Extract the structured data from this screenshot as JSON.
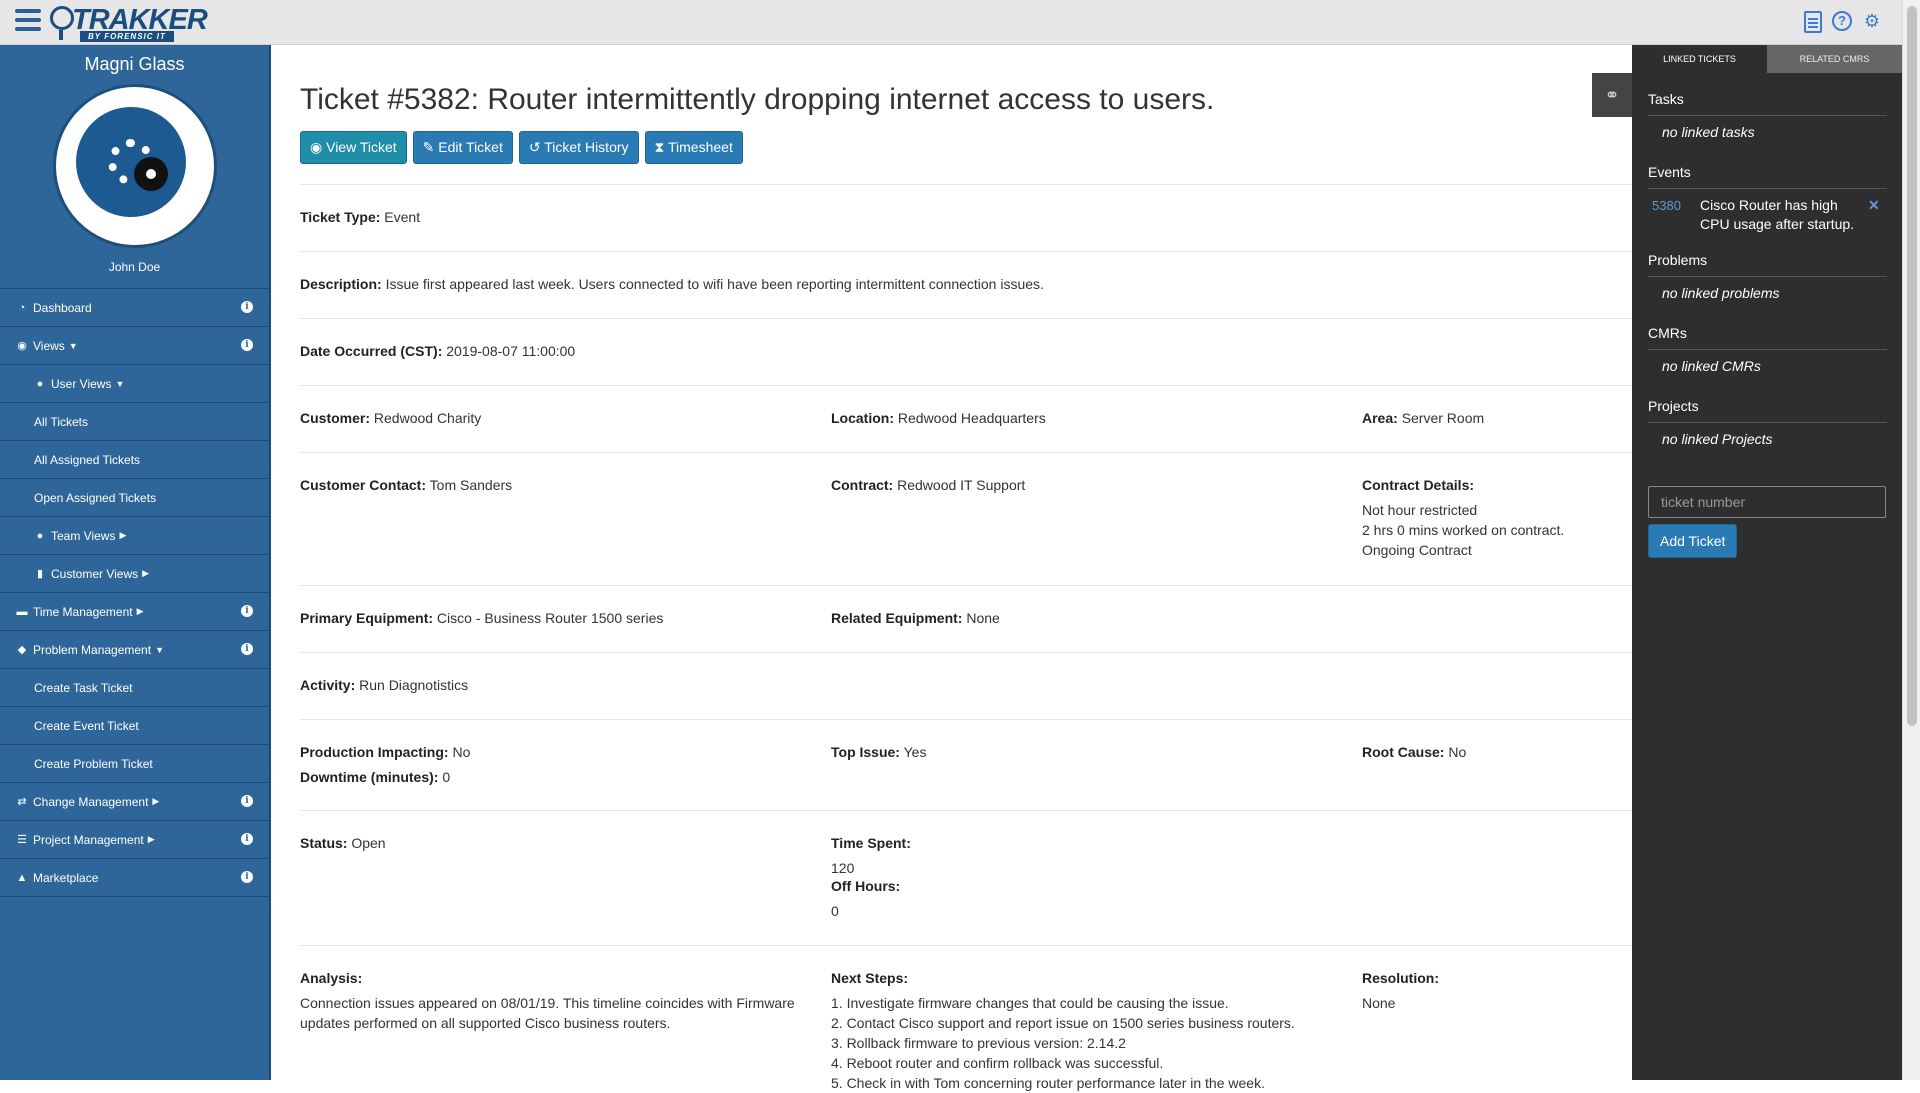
{
  "topbar": {
    "logo_text": "TRAKKER",
    "logo_sub": "BY FORENSIC IT",
    "icons": [
      "document-icon",
      "help-icon",
      "gear-icon"
    ]
  },
  "sidebar": {
    "profile_name": "Magni Glass",
    "user_name": "John Doe",
    "items": [
      {
        "label": "Dashboard",
        "icon": "dashboard-icon"
      },
      {
        "label": "Views",
        "icon": "eye-icon"
      },
      {
        "label": "User Views",
        "icon": "user-icon"
      },
      {
        "label": "All Tickets"
      },
      {
        "label": "All Assigned Tickets"
      },
      {
        "label": "Open Assigned Tickets"
      },
      {
        "label": "Team Views",
        "icon": "users-icon"
      },
      {
        "label": "Customer Views",
        "icon": "building-icon"
      },
      {
        "label": "Time Management",
        "icon": "book-icon"
      },
      {
        "label": "Problem Management",
        "icon": "tag-icon"
      },
      {
        "label": "Create Task Ticket"
      },
      {
        "label": "Create Event Ticket"
      },
      {
        "label": "Create Problem Ticket"
      },
      {
        "label": "Change Management",
        "icon": "exchange-icon"
      },
      {
        "label": "Project Management",
        "icon": "list-icon"
      },
      {
        "label": "Marketplace",
        "icon": "bank-icon"
      }
    ]
  },
  "ticket": {
    "title": "Ticket #5382: Router intermittently dropping internet access to users.",
    "buttons": {
      "view": "View Ticket",
      "edit": "Edit Ticket",
      "history": "Ticket History",
      "timesheet": "Timesheet"
    },
    "type_label": "Ticket Type:",
    "type_value": "Event",
    "description_label": "Description:",
    "description_value": "Issue first appeared last week. Users connected to wifi have been reporting intermittent connection issues.",
    "date_label": "Date Occurred (CST):",
    "date_value": "2019-08-07 11:00:00",
    "customer_label": "Customer:",
    "customer_value": "Redwood Charity",
    "location_label": "Location:",
    "location_value": "Redwood Headquarters",
    "area_label": "Area:",
    "area_value": "Server Room",
    "contact_label": "Customer Contact:",
    "contact_value": "Tom Sanders",
    "contract_label": "Contract:",
    "contract_value": "Redwood IT Support",
    "contract_details_label": "Contract Details:",
    "contract_details": [
      "Not hour restricted",
      "2 hrs 0 mins worked on contract.",
      "Ongoing Contract"
    ],
    "primary_equipment_label": "Primary Equipment:",
    "primary_equipment_value": "Cisco - Business Router 1500 series",
    "related_equipment_label": "Related Equipment:",
    "related_equipment_value": "None",
    "activity_label": "Activity:",
    "activity_value": "Run Diagnotistics",
    "production_label": "Production Impacting:",
    "production_value": "No",
    "downtime_label": "Downtime (minutes):",
    "downtime_value": "0",
    "top_issue_label": "Top Issue:",
    "top_issue_value": "Yes",
    "root_cause_label": "Root Cause:",
    "root_cause_value": "No",
    "status_label": "Status:",
    "status_value": "Open",
    "time_spent_label": "Time Spent:",
    "time_spent_value": "120",
    "off_hours_label": "Off Hours:",
    "off_hours_value": "0",
    "analysis_label": "Analysis:",
    "analysis_value": "Connection issues appeared on 08/01/19. This timeline coincides with Firmware updates performed on all supported Cisco business routers.",
    "next_steps_label": "Next Steps:",
    "next_steps": [
      "1. Investigate firmware changes that could be causing the issue.",
      "2. Contact Cisco support and report issue on 1500 series business routers.",
      "3. Rollback firmware to previous version: 2.14.2",
      "4. Reboot router and confirm rollback was successful.",
      "5. Check in with Tom concerning router performance later in the week."
    ],
    "resolution_label": "Resolution:",
    "resolution_value": "None"
  },
  "right_panel": {
    "tabs": [
      "LINKED TICKETS",
      "RELATED CMRS"
    ],
    "tasks_head": "Tasks",
    "tasks_empty": "no linked tasks",
    "events_head": "Events",
    "events": [
      {
        "number": "5380",
        "text": "Cisco Router has high CPU usage after startup."
      }
    ],
    "problems_head": "Problems",
    "problems_empty": "no linked problems",
    "cmrs_head": "CMRs",
    "cmrs_empty": "no linked CMRs",
    "projects_head": "Projects",
    "projects_empty": "no linked Projects",
    "input_placeholder": "ticket number",
    "add_button": "Add Ticket"
  }
}
